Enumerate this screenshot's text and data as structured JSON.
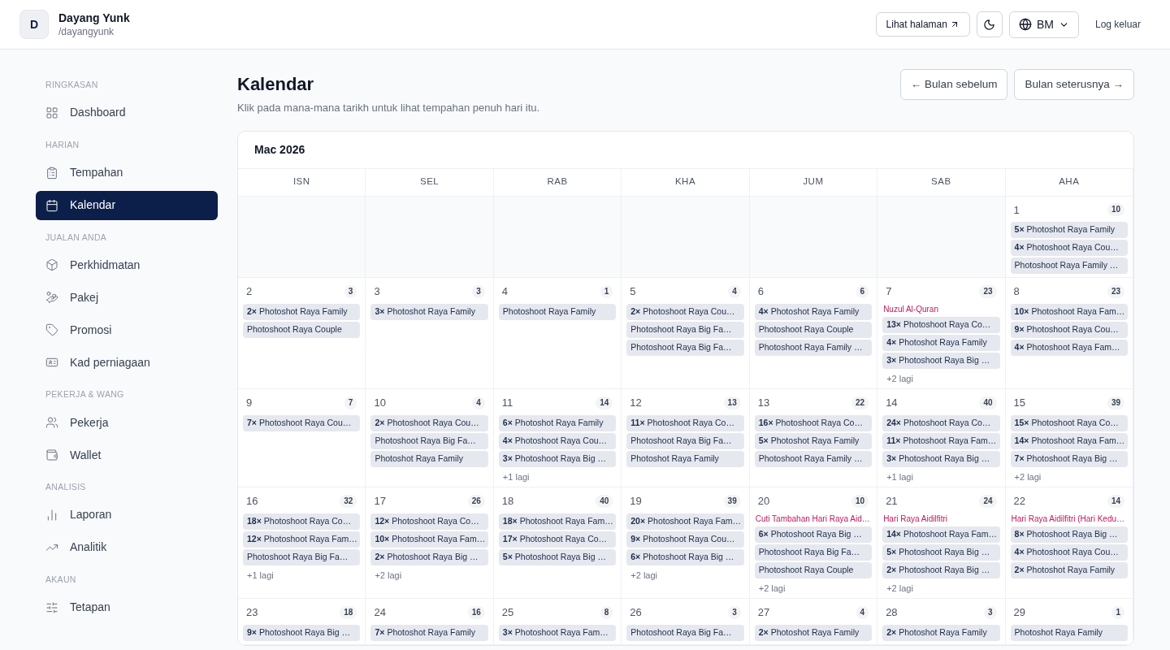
{
  "header": {
    "avatar": "D",
    "name": "Dayang Yunk",
    "handle": "/dayangyunk",
    "view_page": "Lihat halaman",
    "language": "BM",
    "logout": "Log keluar"
  },
  "sidebar": [
    {
      "heading": "RINGKASAN",
      "items": [
        {
          "label": "Dashboard",
          "selected": false
        }
      ]
    },
    {
      "heading": "HARIAN",
      "items": [
        {
          "label": "Tempahan",
          "selected": false
        },
        {
          "label": "Kalendar",
          "selected": true
        }
      ]
    },
    {
      "heading": "JUALAN ANDA",
      "items": [
        {
          "label": "Perkhidmatan",
          "selected": false
        },
        {
          "label": "Pakej",
          "selected": false
        },
        {
          "label": "Promosi",
          "selected": false
        },
        {
          "label": "Kad perniagaan",
          "selected": false
        }
      ]
    },
    {
      "heading": "PEKERJA & WANG",
      "items": [
        {
          "label": "Pekerja",
          "selected": false
        },
        {
          "label": "Wallet",
          "selected": false
        }
      ]
    },
    {
      "heading": "ANALISIS",
      "items": [
        {
          "label": "Laporan",
          "selected": false
        },
        {
          "label": "Analitik",
          "selected": false
        }
      ]
    },
    {
      "heading": "AKAUN",
      "items": [
        {
          "label": "Tetapan",
          "selected": false
        }
      ]
    }
  ],
  "page": {
    "title": "Kalendar",
    "subtitle": "Klik pada mana-mana tarikh untuk lihat tempahan penuh hari itu.",
    "prev": "← Bulan sebelum",
    "next": "Bulan seterusnya →"
  },
  "calendar": {
    "month": "Mac 2026",
    "weekdays": [
      "ISN",
      "SEL",
      "RAB",
      "KHA",
      "JUM",
      "SAB",
      "AHA"
    ],
    "weeks": [
      [
        {
          "kind": "empty"
        },
        {
          "kind": "empty"
        },
        {
          "kind": "empty"
        },
        {
          "kind": "empty"
        },
        {
          "kind": "empty"
        },
        {
          "kind": "empty"
        },
        {
          "kind": "day",
          "date": "1",
          "total": "10",
          "bookings": [
            {
              "count": "5×",
              "label": "Photoshot Raya Family"
            },
            {
              "count": "4×",
              "label": "Photoshoot Raya Cou…"
            },
            {
              "label": "Photoshoot Raya Family …"
            }
          ]
        }
      ],
      [
        {
          "kind": "day",
          "date": "2",
          "total": "3",
          "bookings": [
            {
              "count": "2×",
              "label": "Photoshot Raya Family"
            },
            {
              "label": "Photoshoot Raya Couple"
            }
          ]
        },
        {
          "kind": "day",
          "date": "3",
          "total": "3",
          "bookings": [
            {
              "count": "3×",
              "label": "Photoshot Raya Family"
            }
          ]
        },
        {
          "kind": "day",
          "date": "4",
          "total": "1",
          "bookings": [
            {
              "label": "Photoshoot Raya Family"
            }
          ]
        },
        {
          "kind": "day",
          "date": "5",
          "total": "4",
          "bookings": [
            {
              "count": "2×",
              "label": "Photoshoot Raya Cou…"
            },
            {
              "label": "Photoshoot Raya Big Fa…"
            },
            {
              "label": "Photoshoot Raya Big Fa…"
            }
          ]
        },
        {
          "kind": "day",
          "date": "6",
          "total": "6",
          "bookings": [
            {
              "count": "4×",
              "label": "Photoshot Raya Family"
            },
            {
              "label": "Photoshoot Raya Couple"
            },
            {
              "label": "Photoshoot Raya Family …"
            }
          ]
        },
        {
          "kind": "day",
          "date": "7",
          "total": "23",
          "holiday": "Nuzul Al-Quran",
          "bookings": [
            {
              "count": "13×",
              "label": "Photoshoot Raya Co…"
            },
            {
              "count": "4×",
              "label": "Photoshot Raya Family"
            },
            {
              "count": "3×",
              "label": "Photoshoot Raya Big …"
            }
          ],
          "more": "+2 lagi"
        },
        {
          "kind": "day",
          "date": "8",
          "total": "23",
          "bookings": [
            {
              "count": "10×",
              "label": "Photoshoot Raya Fam…"
            },
            {
              "count": "9×",
              "label": "Photoshoot Raya Cou…"
            },
            {
              "count": "4×",
              "label": "Photoshoot Raya Fam…"
            }
          ]
        }
      ],
      [
        {
          "kind": "day",
          "date": "9",
          "total": "7",
          "bookings": [
            {
              "count": "7×",
              "label": "Photoshoot Raya Cou…"
            }
          ]
        },
        {
          "kind": "day",
          "date": "10",
          "total": "4",
          "bookings": [
            {
              "count": "2×",
              "label": "Photoshoot Raya Cou…"
            },
            {
              "label": "Photoshoot Raya Big Fa…"
            },
            {
              "label": "Photoshot Raya Family"
            }
          ]
        },
        {
          "kind": "day",
          "date": "11",
          "total": "14",
          "bookings": [
            {
              "count": "6×",
              "label": "Photoshot Raya Family"
            },
            {
              "count": "4×",
              "label": "Photoshoot Raya Cou…"
            },
            {
              "count": "3×",
              "label": "Photoshoot Raya Big …"
            }
          ],
          "more": "+1 lagi"
        },
        {
          "kind": "day",
          "date": "12",
          "total": "13",
          "bookings": [
            {
              "count": "11×",
              "label": "Photoshoot Raya Co…"
            },
            {
              "label": "Photoshoot Raya Big Fa…"
            },
            {
              "label": "Photoshot Raya Family"
            }
          ]
        },
        {
          "kind": "day",
          "date": "13",
          "total": "22",
          "bookings": [
            {
              "count": "16×",
              "label": "Photoshoot Raya Co…"
            },
            {
              "count": "5×",
              "label": "Photoshot Raya Family"
            },
            {
              "label": "Photoshoot Raya Family …"
            }
          ]
        },
        {
          "kind": "day",
          "date": "14",
          "total": "40",
          "bookings": [
            {
              "count": "24×",
              "label": "Photoshoot Raya Co…"
            },
            {
              "count": "11×",
              "label": "Photoshoot Raya Fam…"
            },
            {
              "count": "3×",
              "label": "Photoshoot Raya Big …"
            }
          ],
          "more": "+1 lagi"
        },
        {
          "kind": "day",
          "date": "15",
          "total": "39",
          "bookings": [
            {
              "count": "15×",
              "label": "Photoshoot Raya Co…"
            },
            {
              "count": "14×",
              "label": "Photoshoot Raya Fam…"
            },
            {
              "count": "7×",
              "label": "Photoshoot Raya Big …"
            }
          ],
          "more": "+2 lagi"
        }
      ],
      [
        {
          "kind": "day",
          "date": "16",
          "total": "32",
          "bookings": [
            {
              "count": "18×",
              "label": "Photoshoot Raya Co…"
            },
            {
              "count": "12×",
              "label": "Photoshoot Raya Fam…"
            },
            {
              "label": "Photoshoot Raya Big Fa…"
            }
          ],
          "more": "+1 lagi"
        },
        {
          "kind": "day",
          "date": "17",
          "total": "26",
          "bookings": [
            {
              "count": "12×",
              "label": "Photoshoot Raya Co…"
            },
            {
              "count": "10×",
              "label": "Photoshoot Raya Fam…"
            },
            {
              "count": "2×",
              "label": "Photoshoot Raya Big …"
            }
          ],
          "more": "+2 lagi"
        },
        {
          "kind": "day",
          "date": "18",
          "total": "40",
          "bookings": [
            {
              "count": "18×",
              "label": "Photoshoot Raya Fam…"
            },
            {
              "count": "17×",
              "label": "Photoshoot Raya Co…"
            },
            {
              "count": "5×",
              "label": "Photoshoot Raya Big …"
            }
          ]
        },
        {
          "kind": "day",
          "date": "19",
          "total": "39",
          "bookings": [
            {
              "count": "20×",
              "label": "Photoshoot Raya Fam…"
            },
            {
              "count": "9×",
              "label": "Photoshoot Raya Cou…"
            },
            {
              "count": "6×",
              "label": "Photoshoot Raya Big …"
            }
          ],
          "more": "+2 lagi"
        },
        {
          "kind": "day",
          "date": "20",
          "total": "10",
          "holiday": "Cuti Tambahan Hari Raya Aid…",
          "bookings": [
            {
              "count": "6×",
              "label": "Photoshoot Raya Big …"
            },
            {
              "label": "Photoshoot Raya Big Fa…"
            },
            {
              "label": "Photoshoot Raya Couple"
            }
          ],
          "more": "+2 lagi"
        },
        {
          "kind": "day",
          "date": "21",
          "total": "24",
          "holiday": "Hari Raya Aidilfitri",
          "bookings": [
            {
              "count": "14×",
              "label": "Photoshoot Raya Fam…"
            },
            {
              "count": "5×",
              "label": "Photoshoot Raya Big …"
            },
            {
              "count": "2×",
              "label": "Photoshoot Raya Big …"
            }
          ],
          "more": "+2 lagi"
        },
        {
          "kind": "day",
          "date": "22",
          "total": "14",
          "holiday": "Hari Raya Aidilfitri (Hari Kedu…",
          "bookings": [
            {
              "count": "8×",
              "label": "Photoshoot Raya Big …"
            },
            {
              "count": "4×",
              "label": "Photoshoot Raya Cou…"
            },
            {
              "count": "2×",
              "label": "Photoshot Raya Family"
            }
          ]
        }
      ],
      [
        {
          "kind": "day",
          "date": "23",
          "total": "18",
          "bookings": [
            {
              "count": "9×",
              "label": "Photoshoot Raya Big …"
            }
          ]
        },
        {
          "kind": "day",
          "date": "24",
          "total": "16",
          "bookings": [
            {
              "count": "7×",
              "label": "Photoshot Raya Family"
            }
          ]
        },
        {
          "kind": "day",
          "date": "25",
          "total": "8",
          "bookings": [
            {
              "count": "3×",
              "label": "Photoshoot Raya Fam…"
            }
          ]
        },
        {
          "kind": "day",
          "date": "26",
          "total": "3",
          "bookings": [
            {
              "label": "Photoshoot Raya Big Fa…"
            }
          ]
        },
        {
          "kind": "day",
          "date": "27",
          "total": "4",
          "bookings": [
            {
              "count": "2×",
              "label": "Photoshot Raya Family"
            }
          ]
        },
        {
          "kind": "day",
          "date": "28",
          "total": "3",
          "bookings": [
            {
              "count": "2×",
              "label": "Photoshot Raya Family"
            }
          ]
        },
        {
          "kind": "day",
          "date": "29",
          "total": "1",
          "bookings": [
            {
              "label": "Photoshot Raya Family"
            }
          ]
        }
      ]
    ]
  }
}
